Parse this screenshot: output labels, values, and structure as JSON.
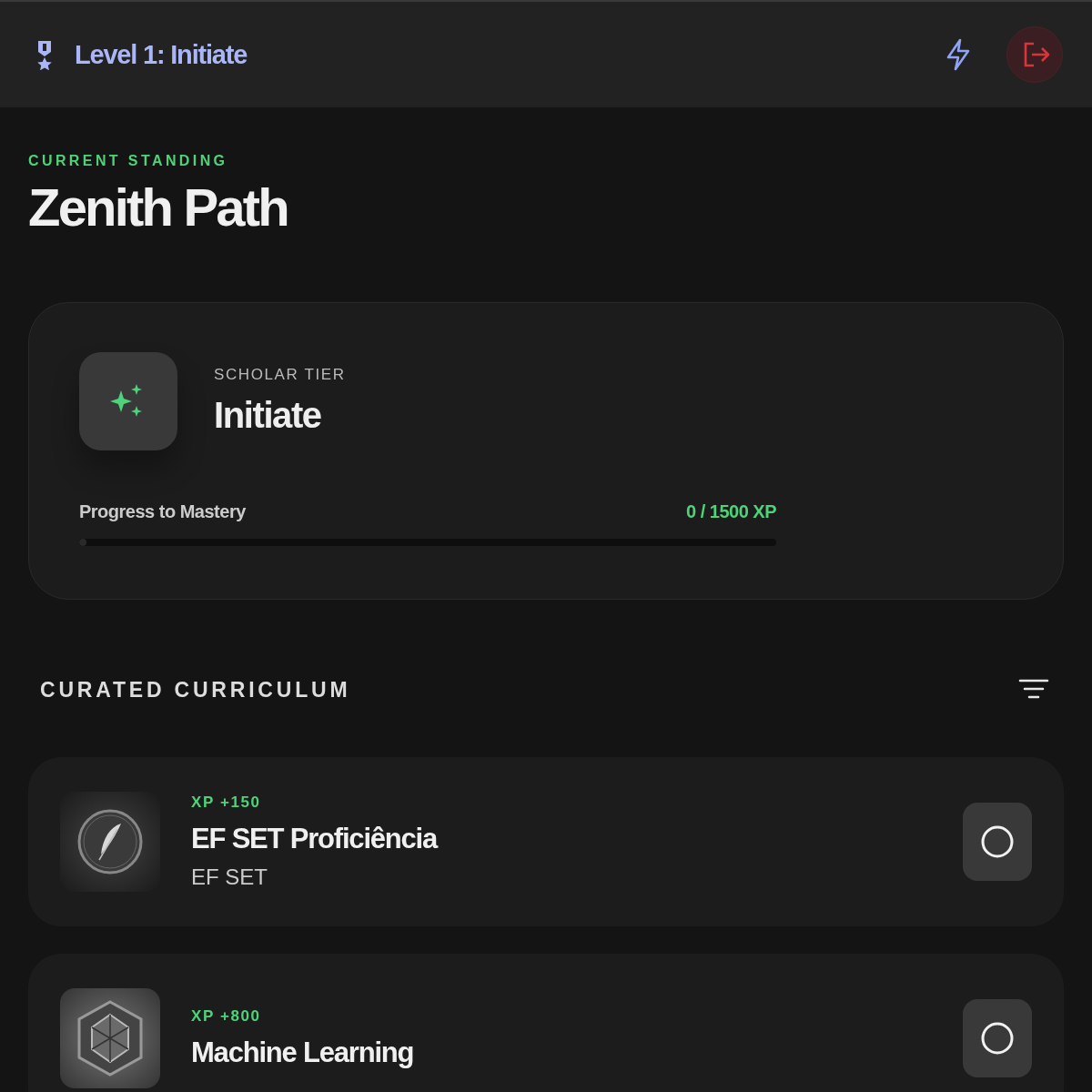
{
  "header": {
    "level_label": "Level 1: Initiate"
  },
  "standing": {
    "eyebrow": "CURRENT STANDING",
    "title": "Zenith Path"
  },
  "tier_card": {
    "eyebrow": "SCHOLAR TIER",
    "tier": "Initiate",
    "progress_label": "Progress to Mastery",
    "progress_reading": "0 / 1500 XP",
    "level": 0
  },
  "curriculum": {
    "heading": "CURATED CURRICULUM",
    "courses": [
      {
        "kind": "feather",
        "xp": "XP +150",
        "title": "EF SET Proficiência",
        "provider": "EF SET",
        "completed": false
      },
      {
        "kind": "gem",
        "xp": "XP +800",
        "title": "Machine Learning",
        "completed": false
      }
    ]
  }
}
